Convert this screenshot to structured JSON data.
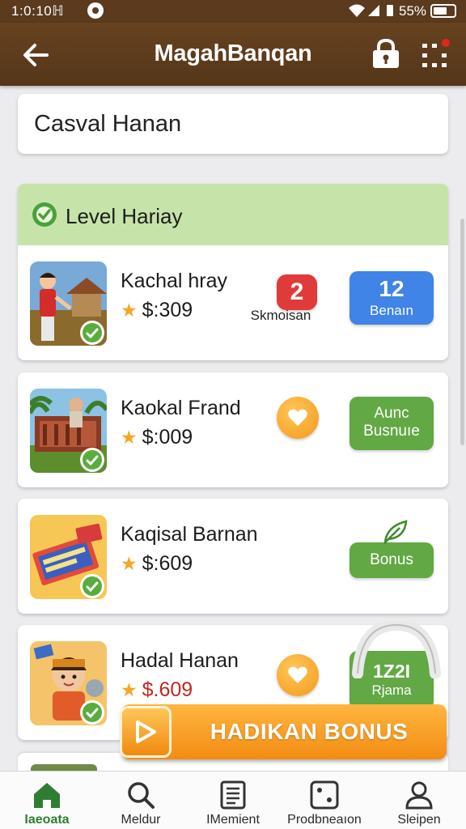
{
  "status_bar": {
    "time": "1:0:10ℍ",
    "battery": "55%"
  },
  "header": {
    "title": "MagahBanqan",
    "back_icon": "arrow-left-icon",
    "lock_icon": "lock-icon",
    "more_icon": "grid-dots-icon"
  },
  "search": {
    "value": "Casval Hanan"
  },
  "level": {
    "title": "Level Hariay"
  },
  "items": [
    {
      "name": "Kachal hray",
      "price": "$:309",
      "count": "2",
      "count_label": "Skmoisan",
      "pill_number": "12",
      "pill_label": "Benaın"
    },
    {
      "name": "Kaokal Frand",
      "price": "$:009",
      "pill_line1": "Aunc",
      "pill_line2": "Busnuıe"
    },
    {
      "name": "Kaqisal Barnan",
      "price": "$:609",
      "pill_label": "Bonus"
    },
    {
      "name": "Hadal Hanan",
      "price": "$.609",
      "pill_number": "1Z2I",
      "pill_label": "Rjama"
    }
  ],
  "cta": {
    "label": "HADIKAN BONUS"
  },
  "bottom_nav": [
    {
      "label": "Iaeoata",
      "icon": "home-icon",
      "active": true
    },
    {
      "label": "Meldur",
      "icon": "search-icon",
      "active": false
    },
    {
      "label": "IMemient",
      "icon": "list-icon",
      "active": false
    },
    {
      "label": "Prodbneaıon",
      "icon": "dice-icon",
      "active": false
    },
    {
      "label": "Sleipen",
      "icon": "person-icon",
      "active": false
    }
  ],
  "colors": {
    "header": "#5b3a1e",
    "level_band": "#c6e4aa",
    "accent_green": "#62a844",
    "accent_blue": "#3f84e6",
    "badge_red": "#e03a3a",
    "cta_orange": "#f5a030"
  }
}
